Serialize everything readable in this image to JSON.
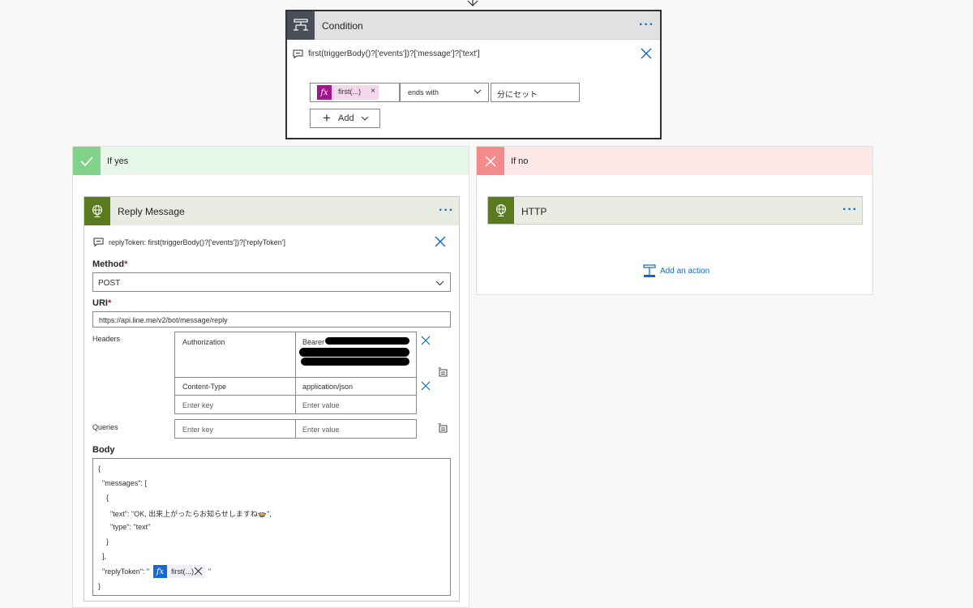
{
  "condition": {
    "title": "Condition",
    "more_label": "···",
    "expression": "first(triggerBody()?['events'])?['message']?['text']",
    "left_operand_token": "first(...)",
    "token_remove": "×",
    "fx_label": "fx",
    "operator": "ends with",
    "right_operand": "分にセット",
    "add_label": "Add"
  },
  "if_yes": {
    "title": "If yes",
    "reply_message": {
      "title": "Reply Message",
      "more_label": "···",
      "reply_token_expr": "replyToken: first(triggerBody()?['events'])?['replyToken']",
      "method_label": "Method",
      "method_value": "POST",
      "uri_label": "URI",
      "uri_value": "https://api.line.me/v2/bot/message/reply",
      "required_marker": "*",
      "headers_label": "Headers",
      "headers": [
        {
          "key": "Authorization",
          "value": "Bearer"
        },
        {
          "key": "Content-Type",
          "value": "application/json"
        }
      ],
      "key_placeholder": "Enter key",
      "value_placeholder": "Enter value",
      "queries_label": "Queries",
      "body_label": "Body",
      "body_lines": [
        "{",
        "  \"messages\": [",
        "    {",
        "      \"text\": \"OK, 出来上がったらお知らせしますね🍲\",",
        "      \"type\": \"text\"",
        "    }",
        "  ],",
        "  \"replyToken\": \"",
        "}"
      ],
      "body_token": "first(...)",
      "body_token_close": "\""
    }
  },
  "if_no": {
    "title": "If no",
    "http": {
      "title": "HTTP",
      "more_label": "···"
    },
    "add_action_label": "Add an action"
  },
  "colors": {
    "accent": "#0f6cbd",
    "condition_icon_bg": "#484f58",
    "yes_green": "#83d28b",
    "no_red": "#f48b8b",
    "action_green": "#5a7a20",
    "fx_purple": "#a0168c",
    "fx_blue": "#1668d8"
  }
}
